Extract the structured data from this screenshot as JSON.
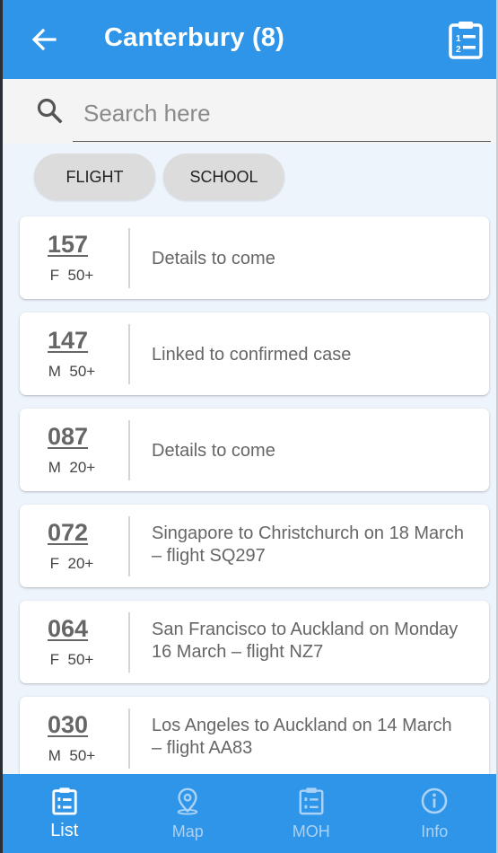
{
  "header": {
    "title": "Canterbury (8)",
    "back_icon": "arrow-left-icon",
    "action_icon": "clipboard-list-icon"
  },
  "search": {
    "placeholder": "Search here",
    "value": ""
  },
  "filters": [
    "FLIGHT",
    "SCHOOL"
  ],
  "cases": [
    {
      "number": "157",
      "sex": "F",
      "age": "50+",
      "details": "Details to come"
    },
    {
      "number": "147",
      "sex": "M",
      "age": "50+",
      "details": "Linked to confirmed case"
    },
    {
      "number": "087",
      "sex": "M",
      "age": "20+",
      "details": "Details to come"
    },
    {
      "number": "072",
      "sex": "F",
      "age": "20+",
      "details": "Singapore to Christchurch on 18 March – flight SQ297"
    },
    {
      "number": "064",
      "sex": "F",
      "age": "50+",
      "details": "San Francisco to Auckland on Monday 16 March – flight NZ7"
    },
    {
      "number": "030",
      "sex": "M",
      "age": "50+",
      "details": "Los Angeles to Auckland on 14 March – flight AA83"
    }
  ],
  "nav": [
    {
      "label": "List",
      "icon": "clipboard-list-icon",
      "active": true
    },
    {
      "label": "Map",
      "icon": "map-pin-icon",
      "active": false
    },
    {
      "label": "MOH",
      "icon": "clipboard-list-icon",
      "active": false
    },
    {
      "label": "Info",
      "icon": "info-icon",
      "active": false
    }
  ],
  "colors": {
    "primary": "#2f95e9",
    "background": "#eef4fc",
    "chip": "#dcdcdc",
    "nav_inactive": "#a9d2f6"
  }
}
